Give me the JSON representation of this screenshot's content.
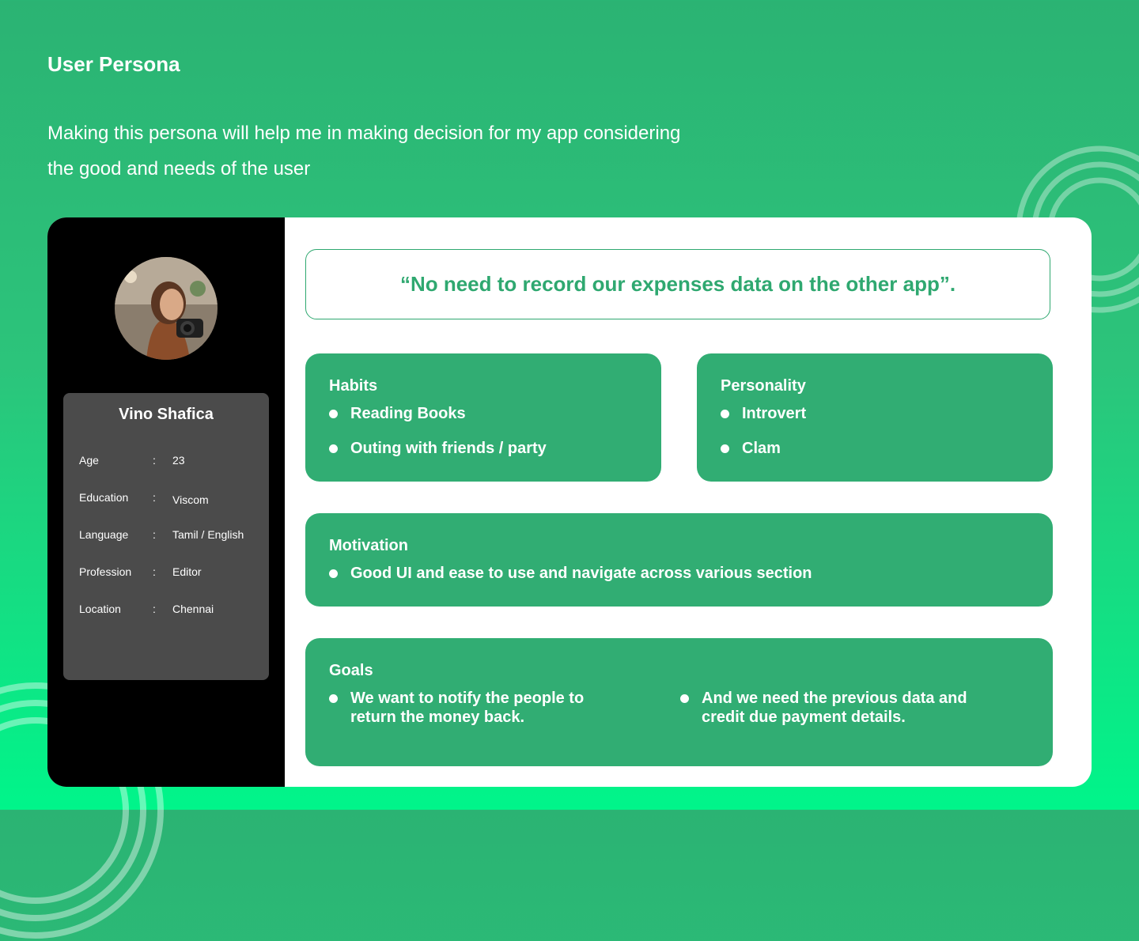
{
  "header": {
    "title": "User Persona",
    "subtitle": "Making this persona will help me in making decision for my app considering the good and needs of the user"
  },
  "profile": {
    "name": "Vino Shafica",
    "fields": [
      {
        "label": "Age",
        "colon": ":",
        "value": "23"
      },
      {
        "label": "Education",
        "colon": ":",
        "value": "Viscom"
      },
      {
        "label": "Language",
        "colon": ":",
        "value": "Tamil / English"
      },
      {
        "label": "Profession",
        "colon": ":",
        "value": "Editor"
      },
      {
        "label": "Location",
        "colon": ":",
        "value": "Chennai"
      }
    ]
  },
  "quote": "“No need to record our expenses data on the other app”.",
  "habits": {
    "title": "Habits",
    "items": [
      "Reading Books",
      "Outing with friends / party"
    ]
  },
  "personality": {
    "title": "Personality",
    "items": [
      "Introvert",
      "Clam"
    ]
  },
  "motivation": {
    "title": "Motivation",
    "items": [
      "Good UI and ease to use and navigate across various section"
    ]
  },
  "goals": {
    "title": "Goals",
    "items": [
      "We want to notify the people to return the money back.",
      "And we need the previous data and credit due payment details."
    ]
  },
  "colors": {
    "accent": "#31ad73",
    "quote_text": "#2fa870",
    "sidebar": "#000000",
    "info_panel": "#4b4b4b"
  },
  "icons": [
    "bullet-icon",
    "decorative-rings-icon",
    "avatar-photo"
  ]
}
